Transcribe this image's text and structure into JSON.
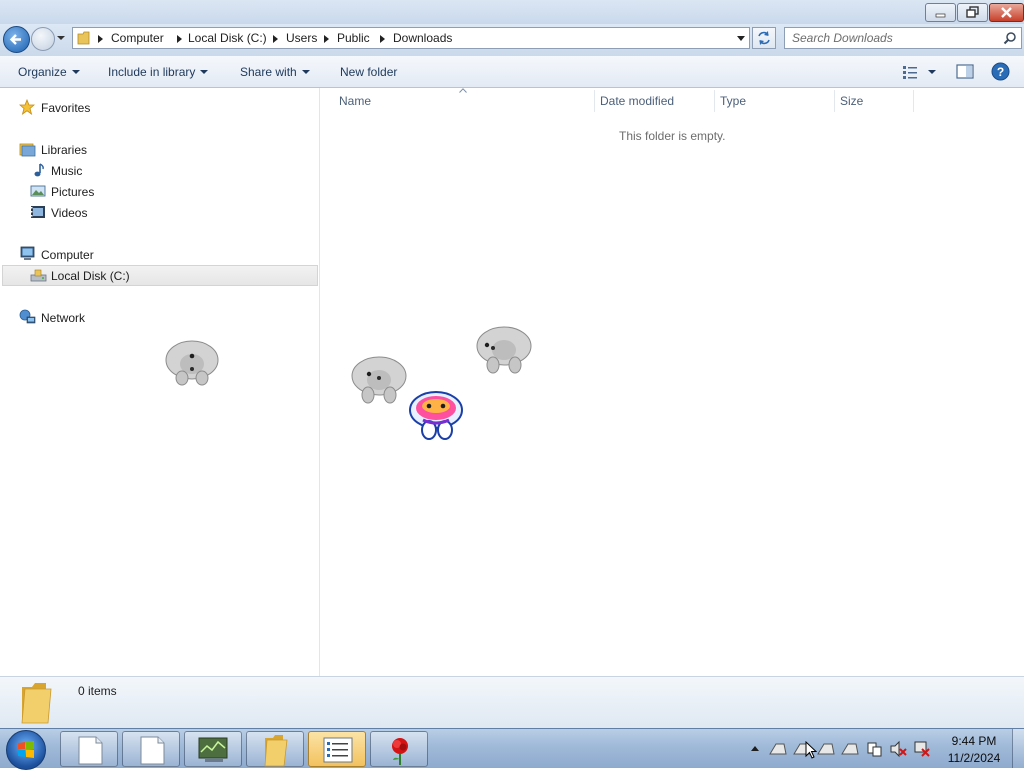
{
  "window": {
    "controls": {
      "minimize": "minimize-icon",
      "restore": "restore-icon",
      "close": "close-icon"
    }
  },
  "address_bar": {
    "crumbs": [
      "Computer",
      "Local Disk (C:)",
      "Users",
      "Public",
      "Downloads"
    ]
  },
  "search": {
    "placeholder": "Search Downloads"
  },
  "toolbar": {
    "organize": "Organize",
    "include_in_library": "Include in library",
    "share_with": "Share with",
    "new_folder": "New folder"
  },
  "nav_pane": {
    "favorites": "Favorites",
    "libraries": "Libraries",
    "music": "Music",
    "pictures": "Pictures",
    "videos": "Videos",
    "computer": "Computer",
    "local_disk": "Local Disk (C:)",
    "network": "Network"
  },
  "columns": {
    "name": "Name",
    "date_modified": "Date modified",
    "type": "Type",
    "size": "Size"
  },
  "content": {
    "empty_message": "This folder is empty."
  },
  "details_pane": {
    "item_count": "0 items"
  },
  "taskbar": {
    "time": "9:44 PM",
    "date": "11/2/2024"
  },
  "colors": {
    "accent": "#1e395b",
    "selection": "#e6e6e6",
    "taskbar": "#9fb9d8"
  }
}
